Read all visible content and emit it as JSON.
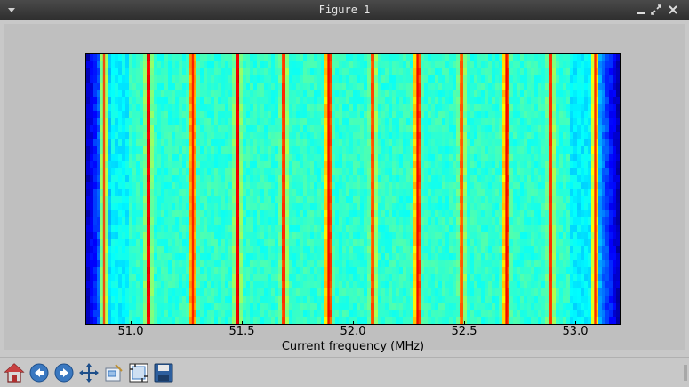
{
  "window": {
    "title": "Figure 1"
  },
  "chart_data": {
    "type": "heatmap",
    "xlabel": "Current frequency (MHz)",
    "ylabel": "",
    "title": "",
    "xlim": [
      50.8,
      53.2
    ],
    "xticks": [
      "51.0",
      "51.5",
      "52.0",
      "52.5",
      "53.0"
    ],
    "xtick_values": [
      51.0,
      51.5,
      52.0,
      52.5,
      53.0
    ],
    "colormap": "jet",
    "bright_lines_mhz": [
      50.88,
      51.08,
      51.28,
      51.48,
      51.69,
      51.89,
      52.09,
      52.29,
      52.49,
      52.69,
      52.89,
      53.09
    ],
    "line_intensity": [
      0.8,
      0.95,
      0.9,
      0.95,
      0.8,
      0.98,
      0.75,
      0.98,
      0.7,
      0.98,
      0.8,
      0.9
    ]
  },
  "toolbar": {
    "buttons": [
      {
        "name": "home-button",
        "icon": "home-icon"
      },
      {
        "name": "back-button",
        "icon": "back-arrow-icon"
      },
      {
        "name": "forward-button",
        "icon": "forward-arrow-icon"
      },
      {
        "name": "pan-button",
        "icon": "pan-arrows-icon"
      },
      {
        "name": "zoom-button",
        "icon": "zoom-rect-icon"
      },
      {
        "name": "configure-subplots-button",
        "icon": "subplots-icon"
      },
      {
        "name": "save-button",
        "icon": "floppy-disk-icon"
      }
    ]
  },
  "colors": {
    "background_field": "#33d4c8",
    "edge": "#1060ff",
    "peak": "#ff4000"
  }
}
